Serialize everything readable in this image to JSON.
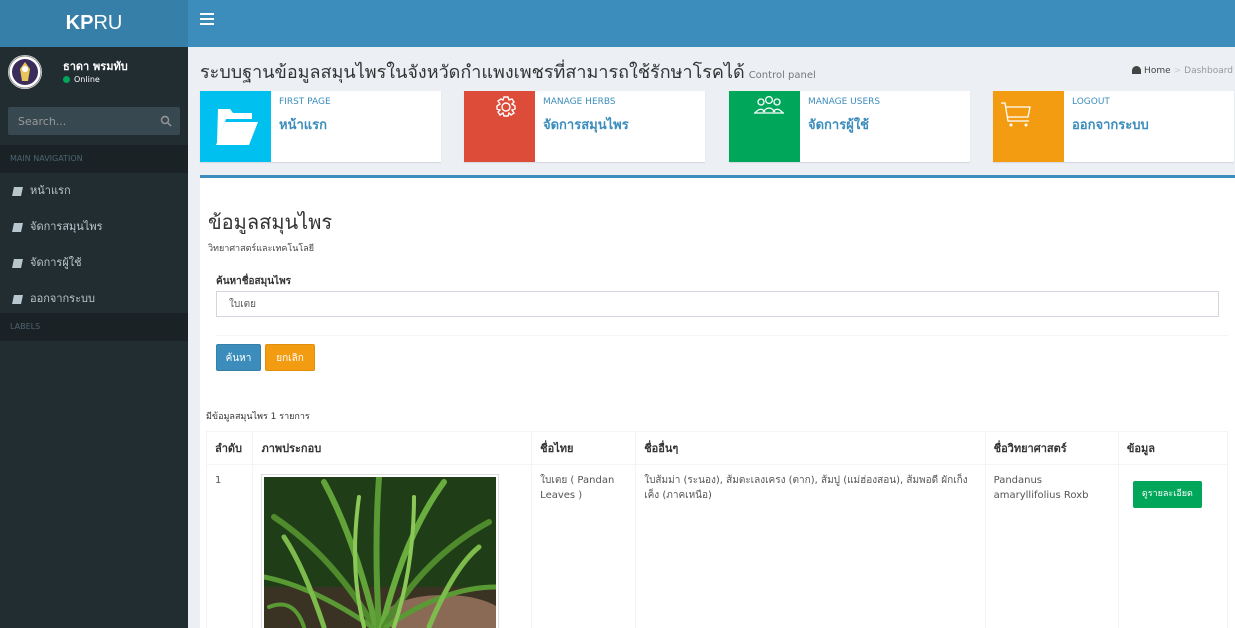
{
  "header": {
    "logo_bold": "KP",
    "logo_rest": "RU"
  },
  "user": {
    "name": "ธาดา พรมทับ",
    "status": "Online"
  },
  "sidebar": {
    "search_placeholder": "Search...",
    "main_nav_header": "MAIN NAVIGATION",
    "labels_header": "LABELS",
    "items": [
      {
        "label": "หน้าแรก"
      },
      {
        "label": "จัดการสมุนไพร"
      },
      {
        "label": "จัดการผู้ใช้"
      },
      {
        "label": "ออกจากระบบ"
      }
    ]
  },
  "page": {
    "title": "ระบบฐานข้อมูลสมุนไพรในจังหวัดกำแพงเพชรที่สามารถใช้รักษาโรคได้",
    "subtitle": "Control panel",
    "breadcrumb_home": "Home",
    "breadcrumb_current": "Dashboard"
  },
  "info_boxes": [
    {
      "small": "FIRST PAGE",
      "big": "หน้าแรก",
      "color": "#00c0ef",
      "icon": "folder-open-icon"
    },
    {
      "small": "MANAGE HERBS",
      "big": "จัดการสมุนไพร",
      "color": "#dd4b39",
      "icon": "gear-icon"
    },
    {
      "small": "MANAGE USERS",
      "big": "จัดการผู้ใช้",
      "color": "#00a65a",
      "icon": "users-icon"
    },
    {
      "small": "LOGOUT",
      "big": "ออกจากระบบ",
      "color": "#f39c12",
      "icon": "cart-icon"
    }
  ],
  "panel": {
    "title": "ข้อมูลสมุนไพร",
    "sub": "วิทยาศาสตร์และเทคโนโลยี",
    "search_label": "ค้นหาชื่อสมุนไพร",
    "search_value": "ใบเตย",
    "search_button": "ค้นหา",
    "cancel_button": "ยกเลิก",
    "count_text": "มีข้อมูลสมุนไพร 1 รายการ"
  },
  "table": {
    "headers": [
      "ลำดับ",
      "ภาพประกอบ",
      "ชื่อไทย",
      "ชื่ออื่นๆ",
      "ชื่อวิทยาศาสตร์",
      "ข้อมูล"
    ],
    "rows": [
      {
        "no": "1",
        "thai_name": "ใบเตย ( Pandan Leaves )",
        "other_names": "ใบส้มม่า (ระนอง), ส้มตะเลงเครง (ตาก), ส้มปู (แม่ฮ่องสอน), ส้มพอดี ผักเก็งเค็ง (ภาคเหนือ)",
        "sci_name": "Pandanus amaryllifolius Roxb",
        "detail_button": "ดูรายละเอียด"
      }
    ]
  },
  "colors": {
    "header": "#3c8dbc",
    "logo_bg": "#367fa9",
    "sidebar": "#222d32",
    "accent_green": "#00a65a",
    "accent_orange": "#f39c12"
  }
}
